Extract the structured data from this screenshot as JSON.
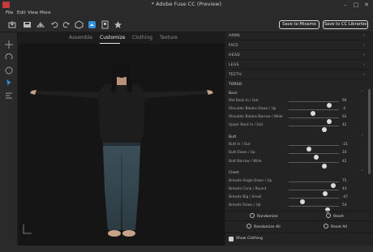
{
  "app": {
    "title": "* Adobe Fuse CC (Preview)"
  },
  "menu": [
    "File",
    "Edit",
    "View",
    "More"
  ],
  "toolbar": {
    "save_mixamo": "Save to Mixamo",
    "save_cc": "Save to CC Libraries"
  },
  "tabs": [
    {
      "label": "Assemble",
      "active": false
    },
    {
      "label": "Customize",
      "active": true
    },
    {
      "label": "Clothing",
      "active": false
    },
    {
      "label": "Texture",
      "active": false
    }
  ],
  "panel": {
    "sections": [
      "ARMS",
      "FACE",
      "HEAD",
      "LEGS",
      "TEETH"
    ],
    "active_section": "TORSO",
    "groups": [
      {
        "name": "Back",
        "rows": [
          {
            "label": "Mid Back In / Out",
            "value": "60",
            "fraction": 0.8
          },
          {
            "label": "Shoulder Blades Down / Up",
            "value": "-2",
            "fraction": 0.49
          },
          {
            "label": "Shoulder Blades Narrow / Wide",
            "value": "62",
            "fraction": 0.81
          },
          {
            "label": "Upper Back In / Out",
            "value": "42",
            "fraction": 0.71
          }
        ]
      },
      {
        "name": "Butt",
        "rows": [
          {
            "label": "Butt In / Out",
            "value": "-21",
            "fraction": 0.4
          },
          {
            "label": "Butt Down / Up",
            "value": "10",
            "fraction": 0.55
          },
          {
            "label": "Butt Narrow / Wide",
            "value": "42",
            "fraction": 0.71
          }
        ]
      },
      {
        "name": "Chest",
        "rows": [
          {
            "label": "Breasts Angle Down / Up",
            "value": "75",
            "fraction": 0.88
          },
          {
            "label": "Breasts Cone / Round",
            "value": "43",
            "fraction": 0.72
          },
          {
            "label": "Breasts Big / Small",
            "value": "-47",
            "fraction": 0.27
          },
          {
            "label": "Breasts Down / Up",
            "value": "54",
            "fraction": 0.77
          }
        ]
      }
    ],
    "randomize_label": "Randomize",
    "reset_label": "Reset",
    "randomize_all_label": "Randomize All",
    "reset_all_label": "Reset All",
    "show_clothing_label": "Show Clothing",
    "show_clothing_checked": true
  },
  "colors": {
    "accent_blue": "#2f8fd8",
    "brand_red": "#c43b3b"
  }
}
